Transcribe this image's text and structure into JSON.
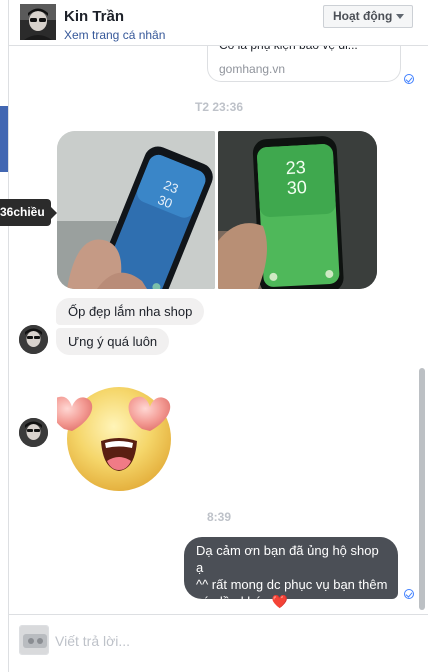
{
  "header": {
    "name": "Kin Trần",
    "profile_link": "Xem trang cá nhân",
    "status_label": "Hoạt động"
  },
  "tooltip": {
    "text": "36chiều"
  },
  "link_card": {
    "cut_text": "Có là phụ kiện bảo vệ di...",
    "domain": "gomhang.vn"
  },
  "timestamps": {
    "first": "T2 23:36",
    "second": "8:39"
  },
  "messages": {
    "incoming": [
      "Ốp đẹp lắm nha shop",
      "Ưng ý quá luôn"
    ],
    "outgoing_lines": [
      "Dạ cảm ơn bạn đã ủng hộ shop ạ",
      "^^ rất mong dc phục vụ bạn thêm",
      "các lần khác"
    ],
    "outgoing_heart": "❤️"
  },
  "photos": {
    "lock_time_hour": "23",
    "lock_time_min": "30"
  },
  "composer": {
    "placeholder": "Viết trả lời..."
  },
  "colors": {
    "link": "#365899",
    "seen_blue": "#4080ff",
    "outgoing_bubble": "#4b4f56",
    "incoming_bubble": "#f1f0f0"
  }
}
